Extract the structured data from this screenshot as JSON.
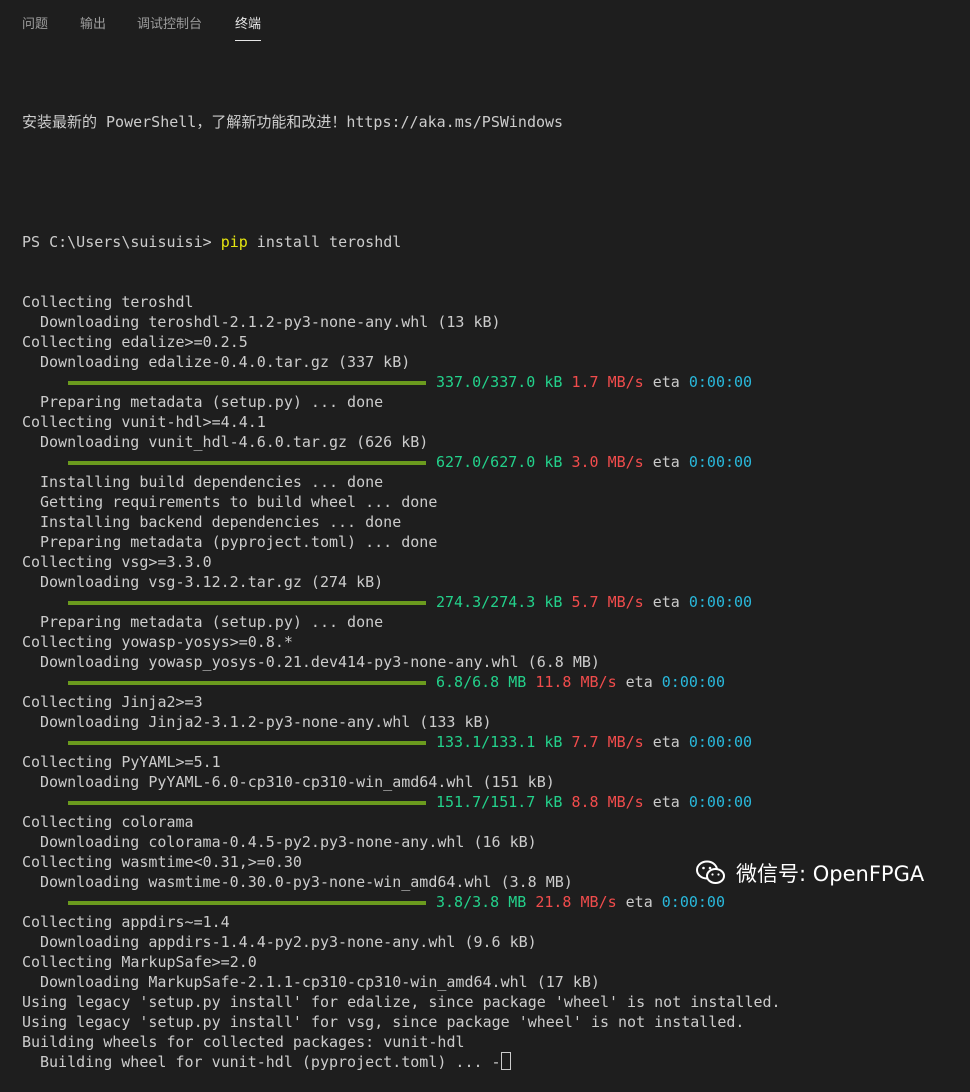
{
  "tabs": [
    {
      "label": "问题",
      "active": false
    },
    {
      "label": "输出",
      "active": false
    },
    {
      "label": "调试控制台",
      "active": false
    },
    {
      "label": "终端",
      "active": true
    }
  ],
  "terminal": {
    "banner": "安装最新的 PowerShell，了解新功能和改进！https://aka.ms/PSWindows",
    "prompt": "PS C:\\Users\\suisuisi> ",
    "command_name": "pip",
    "command_args": " install teroshdl",
    "lines": [
      {
        "type": "text",
        "text": "Collecting teroshdl"
      },
      {
        "type": "text",
        "indent": true,
        "text": "Downloading teroshdl-2.1.2-py3-none-any.whl (13 kB)"
      },
      {
        "type": "text",
        "text": "Collecting edalize>=0.2.5"
      },
      {
        "type": "text",
        "indent": true,
        "text": "Downloading edalize-0.4.0.tar.gz (337 kB)"
      },
      {
        "type": "progress",
        "size": "337.0/337.0 kB",
        "speed": "1.7 MB/s",
        "eta_label": "eta",
        "eta": "0:00:00"
      },
      {
        "type": "text",
        "indent": true,
        "text": "Preparing metadata (setup.py) ... done"
      },
      {
        "type": "text",
        "text": "Collecting vunit-hdl>=4.4.1"
      },
      {
        "type": "text",
        "indent": true,
        "text": "Downloading vunit_hdl-4.6.0.tar.gz (626 kB)"
      },
      {
        "type": "progress",
        "size": "627.0/627.0 kB",
        "speed": "3.0 MB/s",
        "eta_label": "eta",
        "eta": "0:00:00"
      },
      {
        "type": "text",
        "indent": true,
        "text": "Installing build dependencies ... done"
      },
      {
        "type": "text",
        "indent": true,
        "text": "Getting requirements to build wheel ... done"
      },
      {
        "type": "text",
        "indent": true,
        "text": "Installing backend dependencies ... done"
      },
      {
        "type": "text",
        "indent": true,
        "text": "Preparing metadata (pyproject.toml) ... done"
      },
      {
        "type": "text",
        "text": "Collecting vsg>=3.3.0"
      },
      {
        "type": "text",
        "indent": true,
        "text": "Downloading vsg-3.12.2.tar.gz (274 kB)"
      },
      {
        "type": "progress",
        "size": "274.3/274.3 kB",
        "speed": "5.7 MB/s",
        "eta_label": "eta",
        "eta": "0:00:00"
      },
      {
        "type": "text",
        "indent": true,
        "text": "Preparing metadata (setup.py) ... done"
      },
      {
        "type": "text",
        "text": "Collecting yowasp-yosys>=0.8.*"
      },
      {
        "type": "text",
        "indent": true,
        "text": "Downloading yowasp_yosys-0.21.dev414-py3-none-any.whl (6.8 MB)"
      },
      {
        "type": "progress",
        "size": "6.8/6.8 MB",
        "speed": "11.8 MB/s",
        "eta_label": "eta",
        "eta": "0:00:00"
      },
      {
        "type": "text",
        "text": "Collecting Jinja2>=3"
      },
      {
        "type": "text",
        "indent": true,
        "text": "Downloading Jinja2-3.1.2-py3-none-any.whl (133 kB)"
      },
      {
        "type": "progress",
        "size": "133.1/133.1 kB",
        "speed": "7.7 MB/s",
        "eta_label": "eta",
        "eta": "0:00:00"
      },
      {
        "type": "text",
        "text": "Collecting PyYAML>=5.1"
      },
      {
        "type": "text",
        "indent": true,
        "text": "Downloading PyYAML-6.0-cp310-cp310-win_amd64.whl (151 kB)"
      },
      {
        "type": "progress",
        "size": "151.7/151.7 kB",
        "speed": "8.8 MB/s",
        "eta_label": "eta",
        "eta": "0:00:00"
      },
      {
        "type": "text",
        "text": "Collecting colorama"
      },
      {
        "type": "text",
        "indent": true,
        "text": "Downloading colorama-0.4.5-py2.py3-none-any.whl (16 kB)"
      },
      {
        "type": "text",
        "text": "Collecting wasmtime<0.31,>=0.30"
      },
      {
        "type": "text",
        "indent": true,
        "text": "Downloading wasmtime-0.30.0-py3-none-win_amd64.whl (3.8 MB)"
      },
      {
        "type": "progress",
        "size": "3.8/3.8 MB",
        "speed": "21.8 MB/s",
        "eta_label": "eta",
        "eta": "0:00:00"
      },
      {
        "type": "text",
        "text": "Collecting appdirs~=1.4"
      },
      {
        "type": "text",
        "indent": true,
        "text": "Downloading appdirs-1.4.4-py2.py3-none-any.whl (9.6 kB)"
      },
      {
        "type": "text",
        "text": "Collecting MarkupSafe>=2.0"
      },
      {
        "type": "text",
        "indent": true,
        "text": "Downloading MarkupSafe-2.1.1-cp310-cp310-win_amd64.whl (17 kB)"
      },
      {
        "type": "text",
        "text": "Using legacy 'setup.py install' for edalize, since package 'wheel' is not installed."
      },
      {
        "type": "text",
        "text": "Using legacy 'setup.py install' for vsg, since package 'wheel' is not installed."
      },
      {
        "type": "text",
        "text": "Building wheels for collected packages: vunit-hdl"
      },
      {
        "type": "text",
        "indent": true,
        "text": "Building wheel for vunit-hdl (pyproject.toml) ... -",
        "cursor": true
      }
    ]
  },
  "watermark": {
    "text": "微信号: OpenFPGA",
    "icon": "wechat-icon"
  },
  "colors": {
    "progress_bar": "#6b9a1e",
    "size_text": "#23d18b",
    "speed_text": "#f14c4c",
    "eta_text": "#29b8db",
    "command_highlight": "#e5e510"
  }
}
